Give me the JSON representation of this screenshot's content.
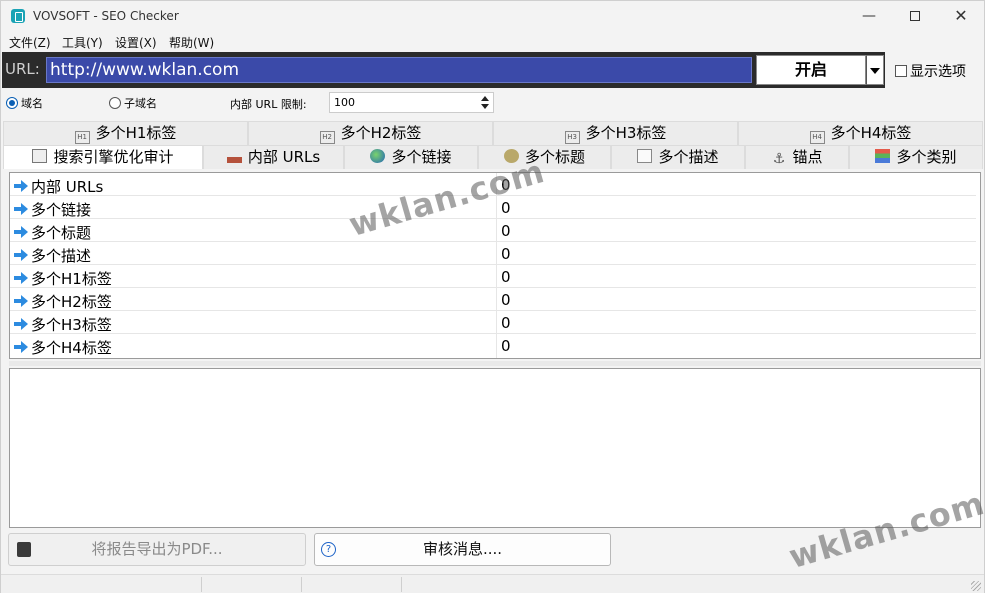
{
  "window": {
    "title": "VOVSOFT - SEO Checker"
  },
  "menu": [
    "文件(Z)",
    "工具(Y)",
    "设置(X)",
    "帮助(W)"
  ],
  "url_bar": {
    "label": "URL:",
    "value": "http://www.wklan.com",
    "start_label": "开启"
  },
  "show_options_label": "显示选项",
  "options": {
    "domain_label": "域名",
    "subdomain_label": "子域名",
    "selected": "域名",
    "limit_label": "内部 URL 限制:",
    "limit_value": "100"
  },
  "tabs_top": [
    {
      "icon": "H1",
      "label": "多个H1标签"
    },
    {
      "icon": "H2",
      "label": "多个H2标签"
    },
    {
      "icon": "H3",
      "label": "多个H3标签"
    },
    {
      "icon": "H4",
      "label": "多个H4标签"
    }
  ],
  "tabs_bottom": [
    {
      "icon": "audit-icon",
      "label": "搜索引擎优化审计",
      "active": true
    },
    {
      "icon": "home-icon",
      "label": "内部 URLs"
    },
    {
      "icon": "globe-icon",
      "label": "多个链接"
    },
    {
      "icon": "title-icon",
      "label": "多个标题"
    },
    {
      "icon": "description-icon",
      "label": "多个描述"
    },
    {
      "icon": "anchor-icon",
      "label": "锚点"
    },
    {
      "icon": "category-icon",
      "label": "多个类别"
    }
  ],
  "results": [
    {
      "name": "内部 URLs",
      "value": "0"
    },
    {
      "name": "多个链接",
      "value": "0"
    },
    {
      "name": "多个标题",
      "value": "0"
    },
    {
      "name": "多个描述",
      "value": "0"
    },
    {
      "name": "多个H1标签",
      "value": "0"
    },
    {
      "name": "多个H2标签",
      "value": "0"
    },
    {
      "name": "多个H3标签",
      "value": "0"
    },
    {
      "name": "多个H4标签",
      "value": "0"
    }
  ],
  "buttons": {
    "export_pdf": "将报告导出为PDF...",
    "audit_message": "审核消息...."
  },
  "watermark": "wklan.com",
  "colors": {
    "url_input_bg": "#3b4aa9",
    "urlbar_bg": "#2b2b2b",
    "arrow": "#2c8be0"
  }
}
